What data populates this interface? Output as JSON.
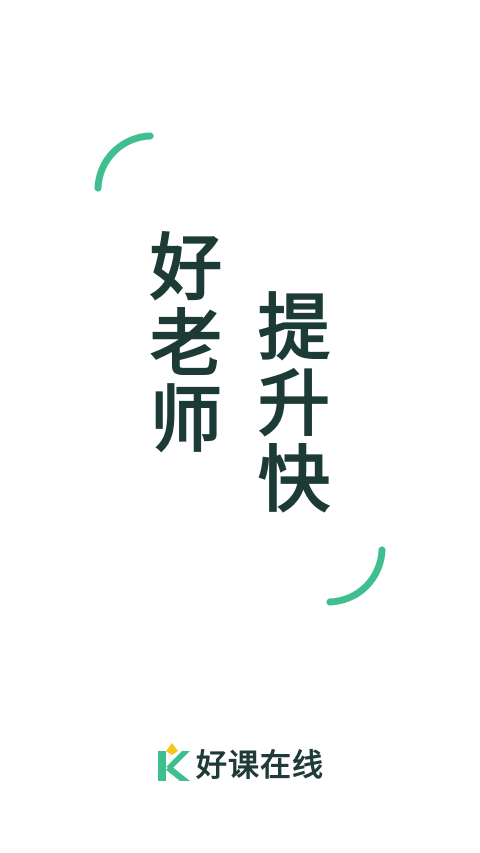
{
  "slogan": {
    "line1": [
      "好",
      "老",
      "师"
    ],
    "line2": [
      "提",
      "升",
      "快"
    ]
  },
  "brand": {
    "logo_icon": "k-logo-icon",
    "name": "好课在线"
  },
  "colors": {
    "accent": "#3fbf8f",
    "text": "#1c3a36",
    "logo_yellow": "#f5c518"
  }
}
